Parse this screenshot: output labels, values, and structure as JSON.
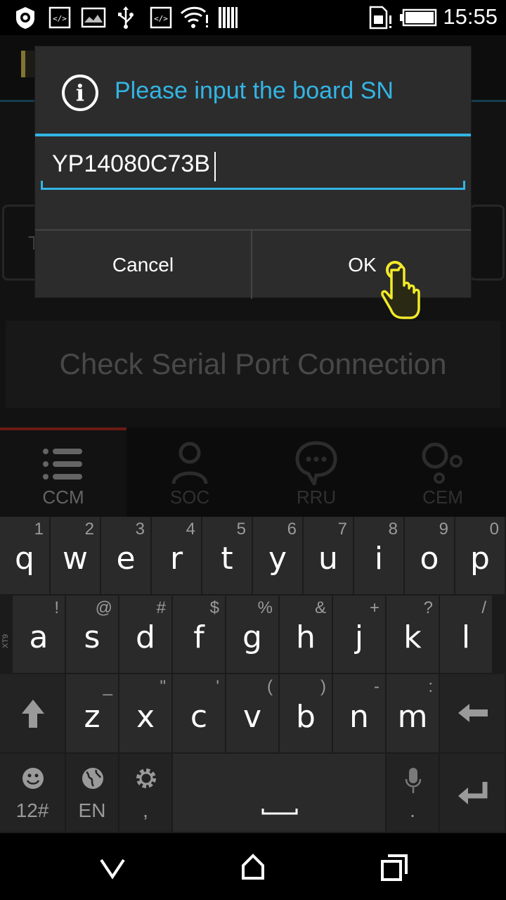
{
  "status_bar": {
    "time": "15:55",
    "icons": [
      "settings-shield-icon",
      "developer-code-icon",
      "image-icon",
      "usb-icon",
      "developer-code-icon",
      "wifi-alert-icon",
      "barcode-icon",
      "sim-alert-icon",
      "battery-icon"
    ]
  },
  "app": {
    "background_field_letter": "T",
    "check_serial_button": "Check Serial Port Connection",
    "tabs": [
      {
        "label": "CCM",
        "icon": "list-icon",
        "active": true
      },
      {
        "label": "SOC",
        "icon": "person-icon",
        "active": false
      },
      {
        "label": "RRU",
        "icon": "chat-bubble-icon",
        "active": false
      },
      {
        "label": "CEM",
        "icon": "circles-icon",
        "active": false
      }
    ]
  },
  "dialog": {
    "title": "Please input the board SN",
    "input_value": "YP14080C73B",
    "cancel_label": "Cancel",
    "ok_label": "OK"
  },
  "keyboard": {
    "row1": [
      {
        "key": "q",
        "sub": "1"
      },
      {
        "key": "w",
        "sub": "2"
      },
      {
        "key": "e",
        "sub": "3"
      },
      {
        "key": "r",
        "sub": "4"
      },
      {
        "key": "t",
        "sub": "5"
      },
      {
        "key": "y",
        "sub": "6"
      },
      {
        "key": "u",
        "sub": "7"
      },
      {
        "key": "i",
        "sub": "8"
      },
      {
        "key": "o",
        "sub": "9"
      },
      {
        "key": "p",
        "sub": "0"
      }
    ],
    "row2": [
      {
        "key": "a",
        "sub": "!"
      },
      {
        "key": "s",
        "sub": "@"
      },
      {
        "key": "d",
        "sub": "#"
      },
      {
        "key": "f",
        "sub": "$"
      },
      {
        "key": "g",
        "sub": "%"
      },
      {
        "key": "h",
        "sub": "&"
      },
      {
        "key": "j",
        "sub": "+"
      },
      {
        "key": "k",
        "sub": "?"
      },
      {
        "key": "l",
        "sub": "/"
      }
    ],
    "row3": [
      {
        "key": "z",
        "sub": "_"
      },
      {
        "key": "x",
        "sub": "\""
      },
      {
        "key": "c",
        "sub": "'"
      },
      {
        "key": "v",
        "sub": "("
      },
      {
        "key": "b",
        "sub": ")"
      },
      {
        "key": "n",
        "sub": "-"
      },
      {
        "key": "m",
        "sub": ":"
      }
    ],
    "side_label": "XT9",
    "symbols_label": "12#",
    "language_label": "EN",
    "comma": ",",
    "period": "."
  },
  "colors": {
    "accent": "#33b5e5",
    "active_tab_indicator": "#a5291f",
    "touch_pointer": "#f2ea2a"
  }
}
